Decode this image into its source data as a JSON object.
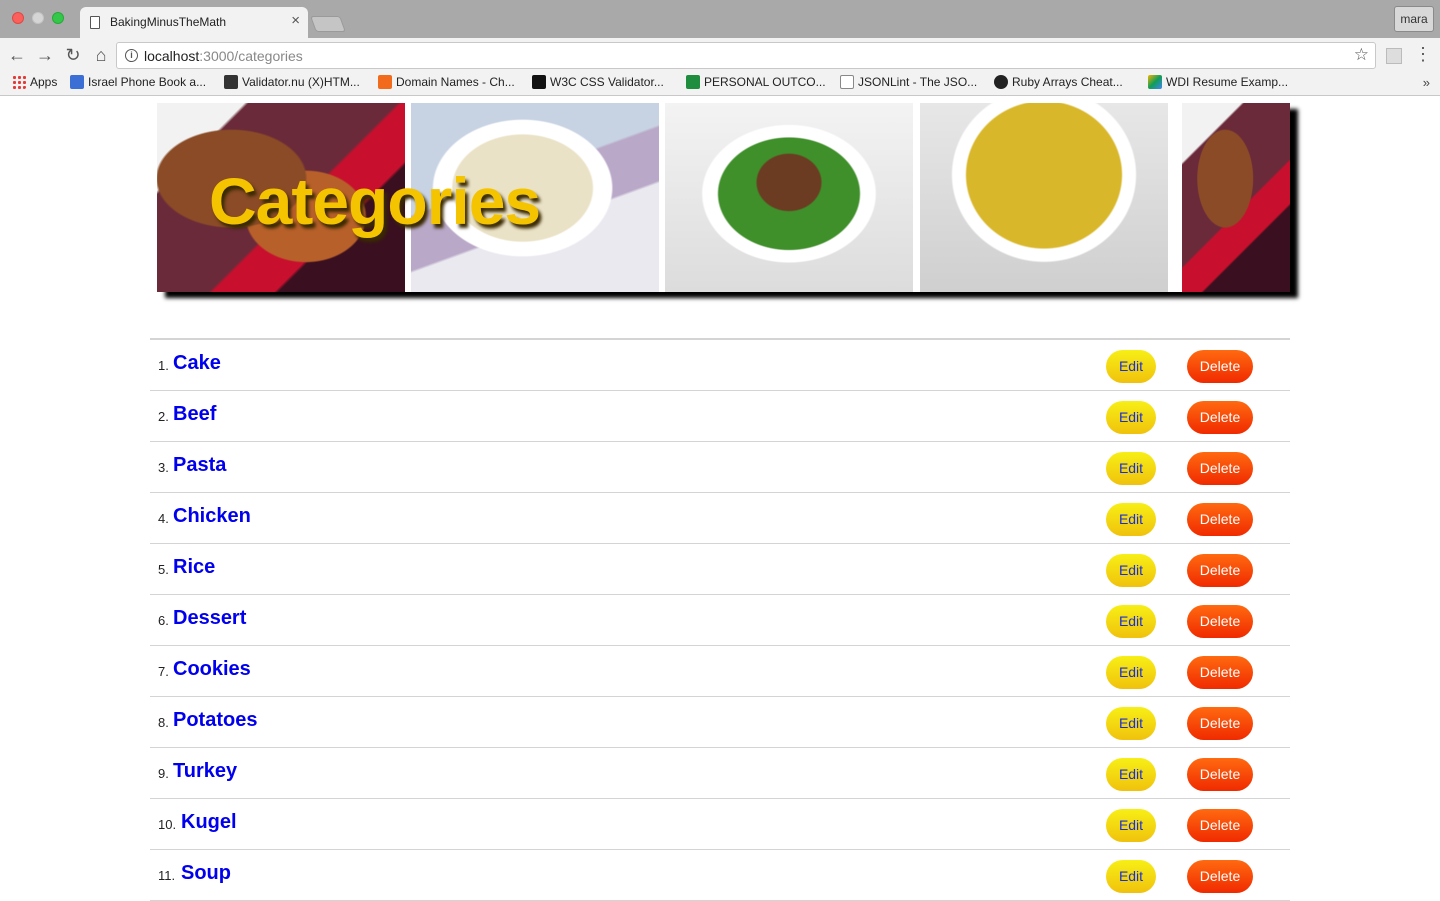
{
  "browser": {
    "tab_title": "BakingMinusTheMath",
    "tab_close": "×",
    "profile_name": "mara",
    "url_host": "localhost",
    "url_path": ":3000/categories",
    "nav": {
      "back": "←",
      "forward": "→",
      "reload": "↻",
      "home": "⌂",
      "star": "☆",
      "menu": "⋮",
      "info": "i"
    },
    "bookmarks": [
      {
        "label": "Apps",
        "icon": "apps-grid-icon",
        "color": "#e53935"
      },
      {
        "label": "Israel Phone Book a...",
        "icon": "flag-icon",
        "color": "#3b6fd6"
      },
      {
        "label": "Validator.nu (X)HTM...",
        "icon": "validator-icon",
        "color": "#333333"
      },
      {
        "label": "Domain Names - Ch...",
        "icon": "domain-icon",
        "color": "#f26b1d"
      },
      {
        "label": "W3C CSS Validator...",
        "icon": "w3c-icon",
        "color": "#111111"
      },
      {
        "label": "PERSONAL OUTCO...",
        "icon": "sheets-icon",
        "color": "#1e8e3e"
      },
      {
        "label": "JSONLint - The JSO...",
        "icon": "braces-icon",
        "color": "#444444"
      },
      {
        "label": "Ruby Arrays Cheat...",
        "icon": "glasses-icon",
        "color": "#222222"
      },
      {
        "label": "WDI Resume Examp...",
        "icon": "drive-icon",
        "color": "#f4b400"
      }
    ],
    "bookmarks_more": "»"
  },
  "page": {
    "banner_title": "Categories",
    "edit_label": "Edit",
    "delete_label": "Delete",
    "categories": [
      {
        "index": "1.",
        "name": "Cake"
      },
      {
        "index": "2.",
        "name": "Beef"
      },
      {
        "index": "3.",
        "name": "Pasta"
      },
      {
        "index": "4.",
        "name": "Chicken"
      },
      {
        "index": "5.",
        "name": "Rice"
      },
      {
        "index": "6.",
        "name": "Dessert"
      },
      {
        "index": "7.",
        "name": "Cookies"
      },
      {
        "index": "8.",
        "name": "Potatoes"
      },
      {
        "index": "9.",
        "name": "Turkey"
      },
      {
        "index": "10.",
        "name": "Kugel"
      },
      {
        "index": "11.",
        "name": "Soup"
      }
    ],
    "colors": {
      "link": "#0000ee",
      "edit_button": "#f3d60f",
      "delete_button": "#ff4a08",
      "title": "#f5c400"
    }
  }
}
